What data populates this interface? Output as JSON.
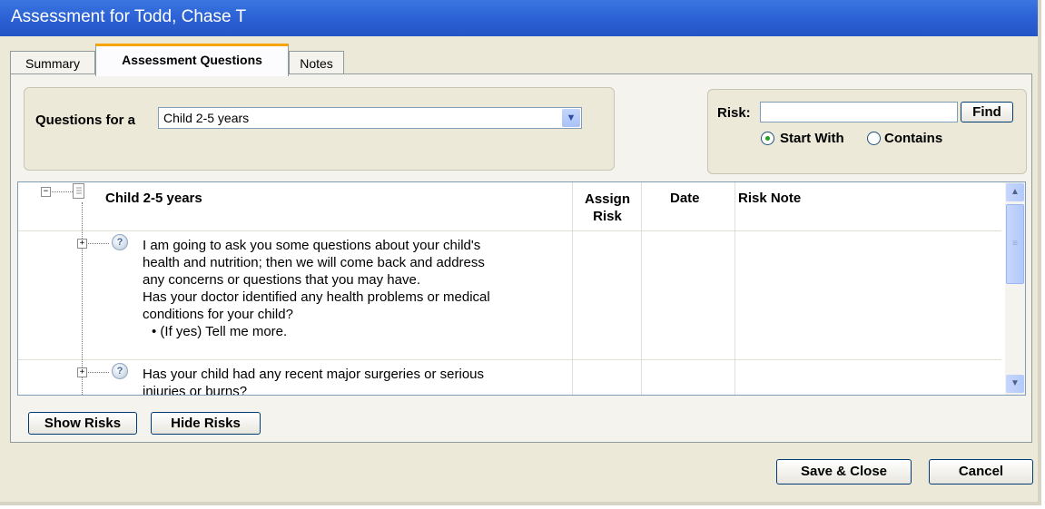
{
  "window": {
    "title": "Assessment for Todd, Chase T"
  },
  "tabs": [
    {
      "label": "Summary",
      "active": false
    },
    {
      "label": "Assessment Questions",
      "active": true
    },
    {
      "label": "Notes",
      "active": false
    }
  ],
  "questions_for": {
    "label": "Questions for a",
    "value": "Child 2-5 years"
  },
  "risk_search": {
    "label": "Risk:",
    "value": "",
    "find_label": "Find",
    "options": [
      {
        "label": "Start With",
        "selected": true
      },
      {
        "label": "Contains",
        "selected": false
      }
    ]
  },
  "grid": {
    "columns": [
      "Assign Risk",
      "Date",
      "Risk Note"
    ],
    "root_label": "Child 2-5 years",
    "rows": [
      {
        "lines": [
          "I am going to ask you some questions about your child's",
          "health and nutrition; then we will come back and address",
          "any concerns or questions that you may have.",
          "Has your doctor identified any health problems or medical",
          "conditions for your child?",
          "• (If yes) Tell me more."
        ]
      },
      {
        "lines": [
          "Has your child had any recent major surgeries or serious",
          "injuries or burns?"
        ]
      }
    ]
  },
  "buttons": {
    "show_risks": "Show Risks",
    "hide_risks": "Hide Risks",
    "save_close": "Save & Close",
    "cancel": "Cancel"
  }
}
